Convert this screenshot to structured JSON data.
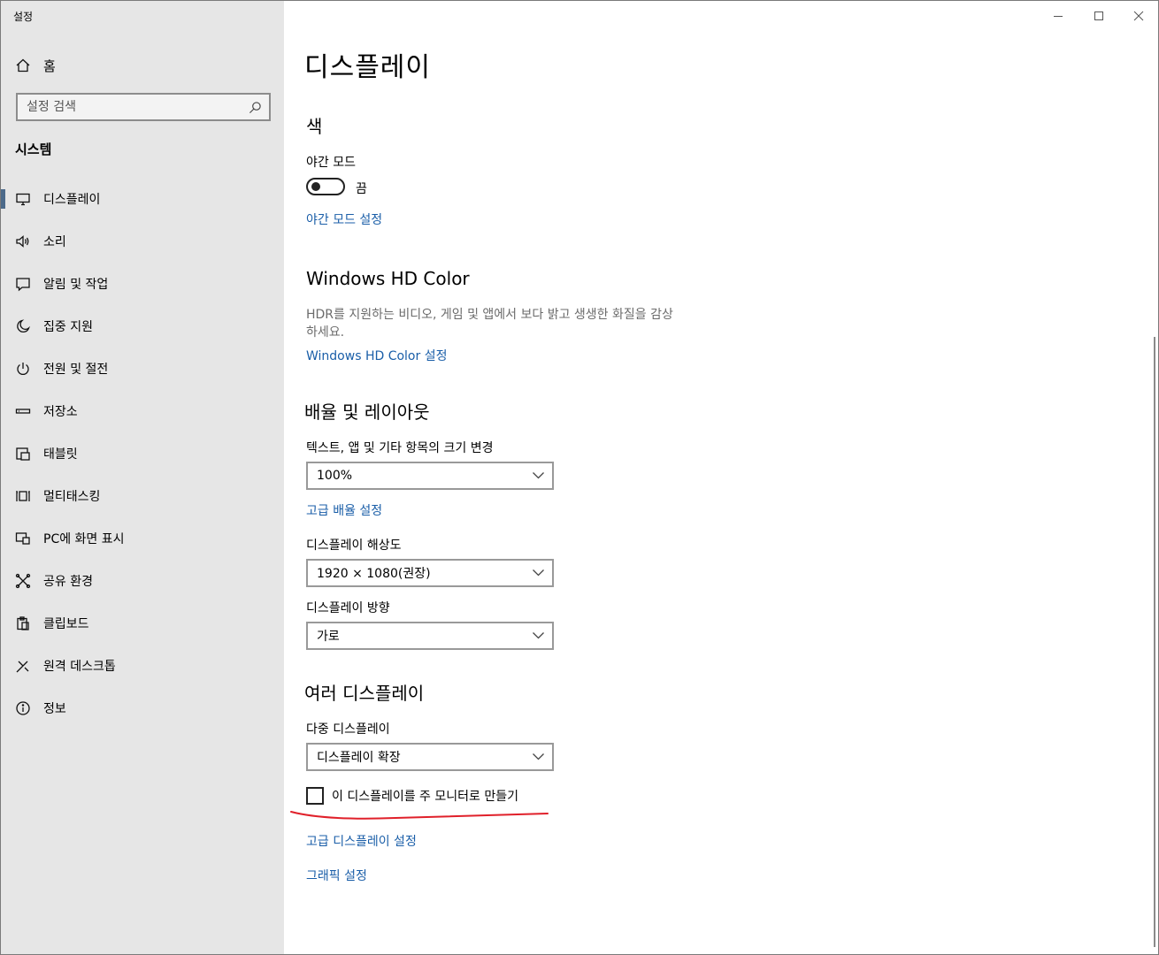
{
  "window": {
    "title": "설정",
    "controls": [
      "minimize-icon",
      "maximize-icon",
      "close-icon"
    ]
  },
  "sidebar": {
    "home_label": "홈",
    "search_placeholder": "설정 검색",
    "section_title": "시스템",
    "items": [
      {
        "label": "디스플레이",
        "icon": "monitor-icon",
        "selected": true
      },
      {
        "label": "소리",
        "icon": "speaker-icon"
      },
      {
        "label": "알림 및 작업",
        "icon": "notification-icon"
      },
      {
        "label": "집중 지원",
        "icon": "moon-icon"
      },
      {
        "label": "전원 및 절전",
        "icon": "power-icon"
      },
      {
        "label": "저장소",
        "icon": "storage-icon"
      },
      {
        "label": "태블릿",
        "icon": "tablet-icon"
      },
      {
        "label": "멀티태스킹",
        "icon": "multitasking-icon"
      },
      {
        "label": "PC에 화면 표시",
        "icon": "project-icon"
      },
      {
        "label": "공유 환경",
        "icon": "shared-experience-icon"
      },
      {
        "label": "클립보드",
        "icon": "clipboard-icon"
      },
      {
        "label": "원격 데스크톱",
        "icon": "remote-desktop-icon"
      },
      {
        "label": "정보",
        "icon": "info-icon"
      }
    ]
  },
  "main": {
    "page_title": "디스플레이",
    "color_section": {
      "title": "색",
      "night_light_label": "야간 모드",
      "toggle_state": "끔",
      "night_light_link": "야간 모드 설정"
    },
    "hd_color_section": {
      "title": "Windows HD Color",
      "description_line1": "HDR를 지원하는 비디오, 게임 및 앱에서 보다 밝고 생생한 화질을 감상",
      "description_line2": "하세요.",
      "link": "Windows HD Color 설정"
    },
    "scale_section": {
      "title": "배율 및 레이아웃",
      "scale_label": "텍스트, 앱 및 기타 항목의 크기 변경",
      "scale_value": "100%",
      "advanced_scale_link": "고급 배율 설정",
      "resolution_label": "디스플레이 해상도",
      "resolution_value": "1920 × 1080(권장)",
      "orientation_label": "디스플레이 방향",
      "orientation_value": "가로"
    },
    "multi_display_section": {
      "title": "여러 디스플레이",
      "multi_label": "다중 디스플레이",
      "multi_value": "디스플레이 확장",
      "main_display_checkbox": "이 디스플레이를 주 모니터로 만들기",
      "checked": false,
      "advanced_display_link": "고급 디스플레이 설정",
      "graphics_link": "그래픽 설정"
    },
    "annotation_color": "#e0202a"
  }
}
